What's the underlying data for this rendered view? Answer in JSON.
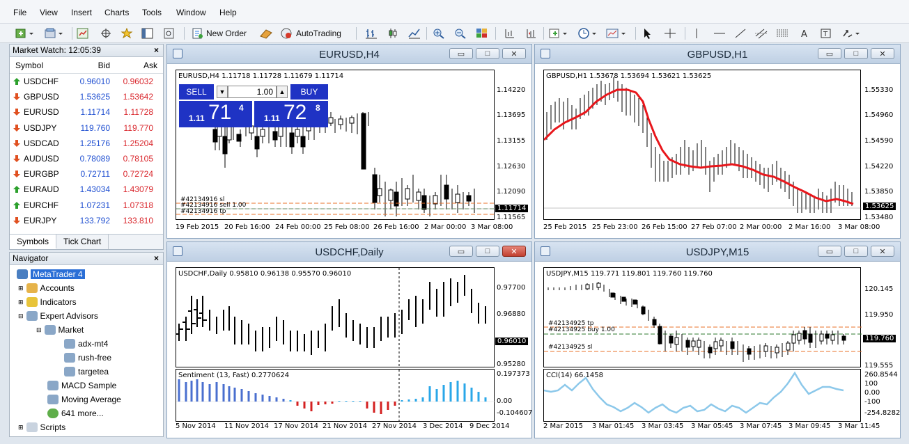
{
  "menu": [
    "File",
    "View",
    "Insert",
    "Charts",
    "Tools",
    "Window",
    "Help"
  ],
  "toolbar": {
    "new_order": "New Order",
    "autotrading": "AutoTrading"
  },
  "market_watch": {
    "title": "Market Watch: 12:05:39",
    "col_symbol": "Symbol",
    "col_bid": "Bid",
    "col_ask": "Ask",
    "rows": [
      {
        "symbol": "USDCHF",
        "bid": "0.96010",
        "ask": "0.96032",
        "dir": "up"
      },
      {
        "symbol": "GBPUSD",
        "bid": "1.53625",
        "ask": "1.53642",
        "dir": "down"
      },
      {
        "symbol": "EURUSD",
        "bid": "1.11714",
        "ask": "1.11728",
        "dir": "down"
      },
      {
        "symbol": "USDJPY",
        "bid": "119.760",
        "ask": "119.770",
        "dir": "down"
      },
      {
        "symbol": "USDCAD",
        "bid": "1.25176",
        "ask": "1.25204",
        "dir": "down"
      },
      {
        "symbol": "AUDUSD",
        "bid": "0.78089",
        "ask": "0.78105",
        "dir": "down"
      },
      {
        "symbol": "EURGBP",
        "bid": "0.72711",
        "ask": "0.72724",
        "dir": "down"
      },
      {
        "symbol": "EURAUD",
        "bid": "1.43034",
        "ask": "1.43079",
        "dir": "up"
      },
      {
        "symbol": "EURCHF",
        "bid": "1.07231",
        "ask": "1.07318",
        "dir": "up"
      },
      {
        "symbol": "EURJPY",
        "bid": "133.792",
        "ask": "133.810",
        "dir": "down"
      }
    ],
    "tabs": [
      "Symbols",
      "Tick Chart"
    ]
  },
  "navigator": {
    "title": "Navigator",
    "items": [
      "MetaTrader 4",
      "Accounts",
      "Indicators",
      "Expert Advisors",
      "Market",
      "adx-mt4",
      "rush-free",
      "targetea",
      "MACD Sample",
      "Moving Average",
      "641 more...",
      "Scripts"
    ]
  },
  "charts": {
    "eurusd": {
      "title": "EURUSD,H4",
      "info": "EURUSD,H4  1.11718 1.11728 1.11679 1.11714",
      "prices": [
        "1.14220",
        "1.13695",
        "1.13155",
        "1.12630",
        "1.12090",
        "1.11565"
      ],
      "current": "1.11714",
      "xlabels": [
        "19 Feb 2015",
        "20 Feb 16:00",
        "24 Feb 00:00",
        "25 Feb 08:00",
        "26 Feb 16:00",
        "2 Mar 00:00",
        "3 Mar 08:00"
      ],
      "orders": [
        "#42134916 sl",
        "#42134916 sell 1.00",
        "#42134916 tp"
      ],
      "sell_label": "SELL",
      "buy_label": "BUY",
      "lot": "1.00",
      "sell_price_small": "1.11",
      "sell_price_big": "71",
      "sell_price_sup": "4",
      "buy_price_small": "1.11",
      "buy_price_big": "72",
      "buy_price_sup": "8"
    },
    "gbpusd": {
      "title": "GBPUSD,H1",
      "info": "GBPUSD,H1  1.53678 1.53694 1.53621 1.53625",
      "prices": [
        "1.55330",
        "1.54960",
        "1.54590",
        "1.54220",
        "1.53850",
        "1.53480"
      ],
      "current": "1.53625",
      "xlabels": [
        "25 Feb 2015",
        "25 Feb 23:00",
        "26 Feb 15:00",
        "27 Feb 07:00",
        "2 Mar 00:00",
        "2 Mar 16:00",
        "3 Mar 08:00"
      ]
    },
    "usdchf": {
      "title": "USDCHF,Daily",
      "info": "USDCHF,Daily  0.95810 0.96138 0.95570 0.96010",
      "prices": [
        "0.97700",
        "0.96880",
        "0.95280"
      ],
      "current": "0.96010",
      "sub_info": "Sentiment (13, Fast) 0.2770624",
      "sub_prices": [
        "0.197373",
        "0.00",
        "-0.104607"
      ],
      "xlabels": [
        "5 Nov 2014",
        "11 Nov 2014",
        "17 Nov 2014",
        "21 Nov 2014",
        "27 Nov 2014",
        "3 Dec 2014",
        "9 Dec 2014"
      ]
    },
    "usdjpy": {
      "title": "USDJPY,M15",
      "info": "USDJPY,M15  119.771 119.801 119.760 119.760",
      "prices": [
        "120.145",
        "119.950",
        "119.555"
      ],
      "current": "119.760",
      "orders": [
        "#42134925 tp",
        "#42134925 buy 1.00",
        "#42134925 sl"
      ],
      "sub_info": "CCI(14) 66.1458",
      "sub_prices": [
        "260.8544",
        "100",
        "0.00",
        "-100",
        "-254.8282"
      ],
      "xlabels": [
        "2 Mar 2015",
        "3 Mar 01:45",
        "3 Mar 03:45",
        "3 Mar 05:45",
        "3 Mar 07:45",
        "3 Mar 09:45",
        "3 Mar 11:45"
      ]
    }
  },
  "colors": {
    "up": "#2ca02c",
    "down": "#e05020",
    "bid": "#1f4fd1",
    "ask": "#d9262c",
    "ma": "#e8161b",
    "cci": "#8cc8ea",
    "hist_pos": "#2aa7e8",
    "hist_blue": "#4a6fcf",
    "hist_neg": "#d42020",
    "trade_blue": "#1f33c4"
  }
}
